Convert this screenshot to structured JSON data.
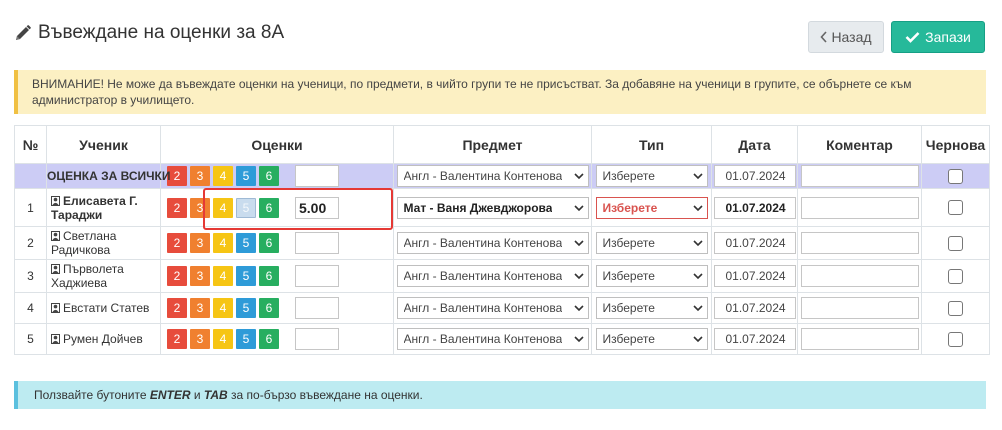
{
  "header": {
    "title": "Въвеждане на оценки за 8А",
    "back_label": "Назад",
    "save_label": "Запази"
  },
  "warning_text": "ВНИМАНИЕ! Не може да въвеждате оценки на ученици, по предмети, в чийто групи те не присъстват. За добавяне на ученици в групите, се обърнете се към администратор в училището.",
  "columns": {
    "num": "№",
    "student": "Ученик",
    "grades": "Оценки",
    "subject": "Предмет",
    "type": "Тип",
    "date": "Дата",
    "comment": "Коментар",
    "draft": "Чернова"
  },
  "grade_buttons": [
    "2",
    "3",
    "4",
    "5",
    "6"
  ],
  "all_row": {
    "label": "ОЦЕНКА ЗА ВСИЧКИ",
    "grade_value": "",
    "subject": "Англ - Валентина Контенова",
    "type": "Изберете",
    "date": "01.07.2024"
  },
  "rows": [
    {
      "num": "1",
      "name": "Елисавета Г. Тараджи",
      "grade_value": "5.00",
      "subject": "Мат - Ваня Джевджорова",
      "type": "Изберете",
      "date": "01.07.2024"
    },
    {
      "num": "2",
      "name": "Светлана Радичкова",
      "grade_value": "",
      "subject": "Англ - Валентина Контенова",
      "type": "Изберете",
      "date": "01.07.2024"
    },
    {
      "num": "3",
      "name": "Първолета Хаджиева",
      "grade_value": "",
      "subject": "Англ - Валентина Контенова",
      "type": "Изберете",
      "date": "01.07.2024"
    },
    {
      "num": "4",
      "name": "Евстати Статев",
      "grade_value": "",
      "subject": "Англ - Валентина Контенова",
      "type": "Изберете",
      "date": "01.07.2024"
    },
    {
      "num": "5",
      "name": "Румен Дойчев",
      "grade_value": "",
      "subject": "Англ - Валентина Контенова",
      "type": "Изберете",
      "date": "01.07.2024"
    }
  ],
  "info": {
    "prefix": "Ползвайте бутоните ",
    "key1": "ENTER",
    "mid": " и ",
    "key2": "TAB",
    "suffix": " за по-бързо въвеждане на оценки."
  },
  "colors": {
    "grade_2": "#e74c3c",
    "grade_3": "#f0802f",
    "grade_4": "#f6c514",
    "grade_5": "#2e9bd8",
    "grade_6": "#27ae60",
    "save_button": "#26b99a",
    "all_row": "#ccccf5",
    "highlight": "#e53935"
  },
  "icons": [
    "pencil-icon",
    "chevron-left-icon",
    "check-icon",
    "student-icon",
    "chevron-down-icon"
  ]
}
